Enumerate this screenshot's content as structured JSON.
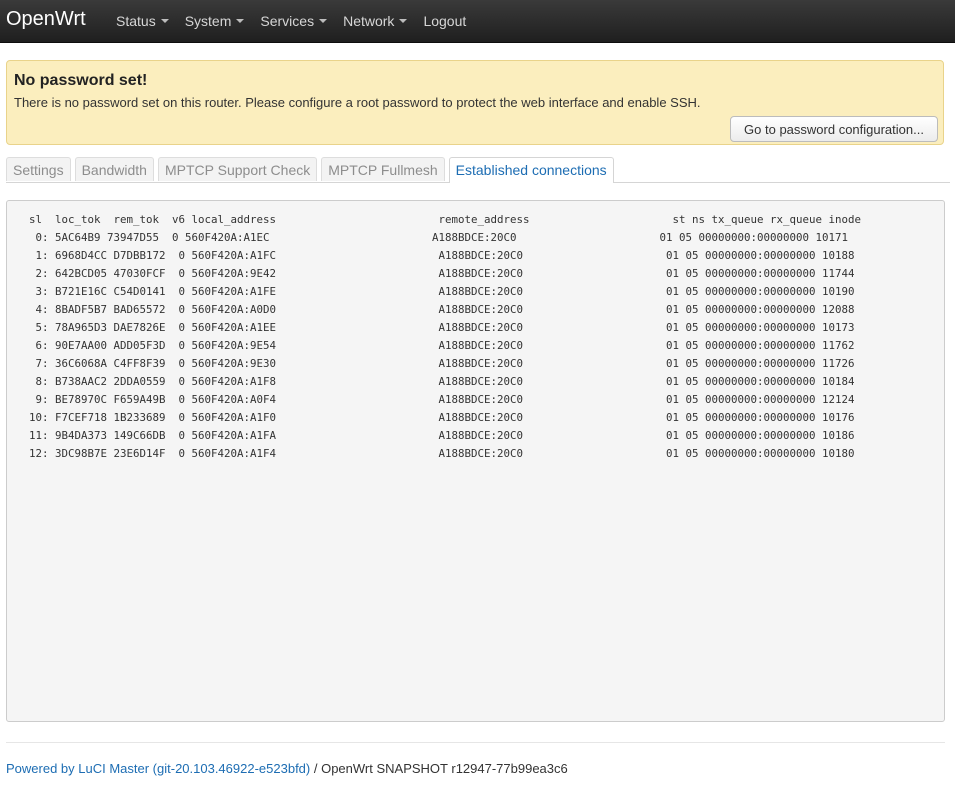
{
  "brand": "OpenWrt",
  "nav": {
    "status": "Status",
    "system": "System",
    "services": "Services",
    "network": "Network",
    "logout": "Logout"
  },
  "alert": {
    "title": "No password set!",
    "text": "There is no password set on this router. Please configure a root password to protect the web interface and enable SSH.",
    "button": "Go to password configuration..."
  },
  "tabs": [
    "Settings",
    "Bandwidth",
    "MPTCP Support Check",
    "MPTCP Fullmesh",
    "Established connections"
  ],
  "connections": {
    "header": "  sl  loc_tok  rem_tok  v6 local_address                         remote_address                      st ns tx_queue rx_queue inode",
    "rows": [
      "   0: 5AC64B9 73947D55  0 560F420A:A1EC                         A188BDCE:20C0                      01 05 00000000:00000000 10171",
      "   1: 6968D4CC D7DBB172  0 560F420A:A1FC                         A188BDCE:20C0                      01 05 00000000:00000000 10188",
      "   2: 642BCD05 47030FCF  0 560F420A:9E42                         A188BDCE:20C0                      01 05 00000000:00000000 11744",
      "   3: B721E16C C54D0141  0 560F420A:A1FE                         A188BDCE:20C0                      01 05 00000000:00000000 10190",
      "   4: 8BADF5B7 BAD65572  0 560F420A:A0D0                         A188BDCE:20C0                      01 05 00000000:00000000 12088",
      "   5: 78A965D3 DAE7826E  0 560F420A:A1EE                         A188BDCE:20C0                      01 05 00000000:00000000 10173",
      "   6: 90E7AA00 ADD05F3D  0 560F420A:9E54                         A188BDCE:20C0                      01 05 00000000:00000000 11762",
      "   7: 36C6068A C4FF8F39  0 560F420A:9E30                         A188BDCE:20C0                      01 05 00000000:00000000 11726",
      "   8: B738AAC2 2DDA0559  0 560F420A:A1F8                         A188BDCE:20C0                      01 05 00000000:00000000 10184",
      "   9: BE78970C F659A49B  0 560F420A:A0F4                         A188BDCE:20C0                      01 05 00000000:00000000 12124",
      "  10: F7CEF718 1B233689  0 560F420A:A1F0                         A188BDCE:20C0                      01 05 00000000:00000000 10176",
      "  11: 9B4DA373 149C66DB  0 560F420A:A1FA                         A188BDCE:20C0                      01 05 00000000:00000000 10186",
      "  12: 3DC98B7E 23E6D14F  0 560F420A:A1F4                         A188BDCE:20C0                      01 05 00000000:00000000 10180"
    ]
  },
  "footer": {
    "link": "Powered by LuCI Master (git-20.103.46922-e523bfd)",
    "text": " / OpenWrt SNAPSHOT r12947-77b99ea3c6"
  },
  "colors": {
    "navbar": "#2a2a2a",
    "alert_bg": "#fbeebe",
    "link": "#1d6db3",
    "panel_bg": "#f5f5f5"
  }
}
